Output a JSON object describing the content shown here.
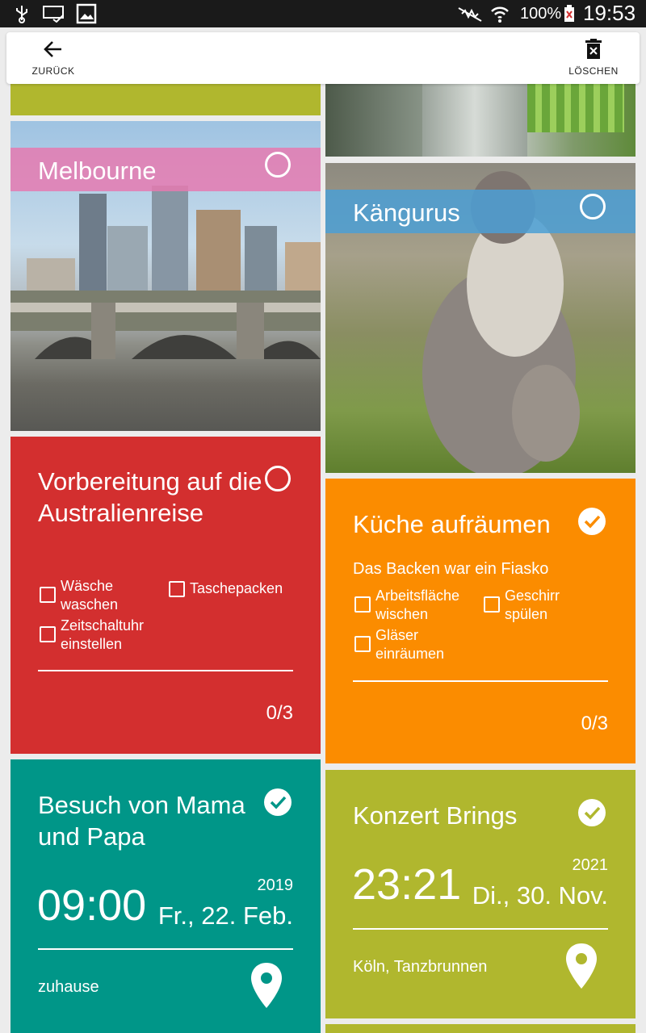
{
  "status_bar": {
    "battery": "100%",
    "time": "19:53"
  },
  "toolbar": {
    "back_label": "ZURÜCK",
    "delete_label": "LÖSCHEN"
  },
  "colors": {
    "olive": "#b0b72e",
    "pink": "#e57ab0",
    "blue": "#4b9fd5",
    "red": "#d32f2f",
    "orange": "#fb8c00",
    "teal": "#009688"
  },
  "cards": {
    "melbourne": {
      "title": "Melbourne"
    },
    "kangaroos": {
      "title": "Kängurus"
    },
    "australia": {
      "title_line1": "Vorbereitung auf die",
      "title_line2": "Australienreise",
      "items": [
        {
          "line1": "Wäsche",
          "line2": "waschen"
        },
        {
          "line1": "Taschepacken",
          "line2": ""
        },
        {
          "line1": "Zeitschaltuhr",
          "line2": "einstellen"
        }
      ],
      "count": "0/3"
    },
    "kitchen": {
      "title": "Küche aufräumen",
      "subtitle": "Das Backen war ein Fiasko",
      "items": [
        {
          "line1": "Arbeitsfläche",
          "line2": "wischen"
        },
        {
          "line1": "Geschirr",
          "line2": "spülen"
        },
        {
          "line1": "Gläser",
          "line2": "einräumen"
        }
      ],
      "count": "0/3"
    },
    "visit": {
      "title_line1": "Besuch von Mama",
      "title_line2": "und Papa",
      "year": "2019",
      "time": "09:00",
      "date": "Fr., 22. Feb.",
      "location": "zuhause"
    },
    "concert": {
      "title": "Konzert Brings",
      "year": "2021",
      "time": "23:21",
      "date": "Di., 30. Nov.",
      "location": "Köln, Tanzbrunnen"
    }
  }
}
